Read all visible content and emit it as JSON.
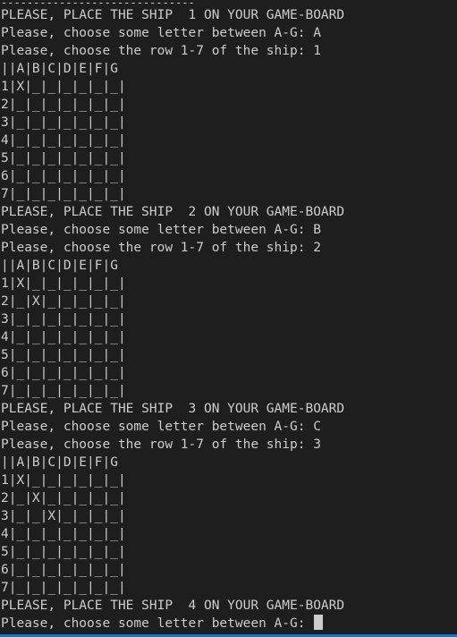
{
  "colors": {
    "background": "#1e1e1e",
    "text": "#cccccc",
    "cursor": "#cccccc",
    "status_bar": "#007acc"
  },
  "separator": "------------------------------",
  "lines": [
    "PLEASE, PLACE THE SHIP  1 ON YOUR GAME-BOARD",
    "Please, choose some letter between A-G: A",
    "Please, choose the row 1-7 of the ship: 1",
    "||A|B|C|D|E|F|G",
    "1|X|_|_|_|_|_|_|",
    "2|_|_|_|_|_|_|_|",
    "3|_|_|_|_|_|_|_|",
    "4|_|_|_|_|_|_|_|",
    "5|_|_|_|_|_|_|_|",
    "6|_|_|_|_|_|_|_|",
    "7|_|_|_|_|_|_|_|",
    "PLEASE, PLACE THE SHIP  2 ON YOUR GAME-BOARD",
    "Please, choose some letter between A-G: B",
    "Please, choose the row 1-7 of the ship: 2",
    "||A|B|C|D|E|F|G",
    "1|X|_|_|_|_|_|_|",
    "2|_|X|_|_|_|_|_|",
    "3|_|_|_|_|_|_|_|",
    "4|_|_|_|_|_|_|_|",
    "5|_|_|_|_|_|_|_|",
    "6|_|_|_|_|_|_|_|",
    "7|_|_|_|_|_|_|_|",
    "PLEASE, PLACE THE SHIP  3 ON YOUR GAME-BOARD",
    "Please, choose some letter between A-G: C",
    "Please, choose the row 1-7 of the ship: 3",
    "||A|B|C|D|E|F|G",
    "1|X|_|_|_|_|_|_|",
    "2|_|X|_|_|_|_|_|",
    "3|_|_|X|_|_|_|_|",
    "4|_|_|_|_|_|_|_|",
    "5|_|_|_|_|_|_|_|",
    "6|_|_|_|_|_|_|_|",
    "7|_|_|_|_|_|_|_|",
    "PLEASE, PLACE THE SHIP  4 ON YOUR GAME-BOARD"
  ],
  "prompt": "Please, choose some letter between A-G: "
}
